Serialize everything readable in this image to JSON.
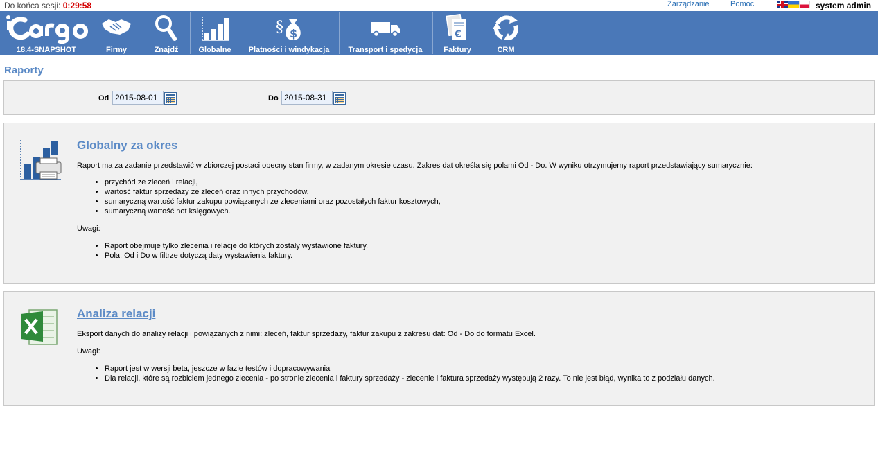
{
  "session": {
    "label": "Do końca sesji:",
    "timer": "0:29:58"
  },
  "toplinks": {
    "management": "Zarządzanie",
    "help": "Pomoc"
  },
  "user": {
    "name": "system admin"
  },
  "nav": {
    "logo_version": "18.4-SNAPSHOT",
    "items": [
      {
        "label": "Firmy",
        "icon": "handshake-icon"
      },
      {
        "label": "Znajdź",
        "icon": "magnifier-icon"
      },
      {
        "label": "Globalne",
        "icon": "bar-chart-icon"
      },
      {
        "label": "Płatności i windykacja",
        "icon": "money-bag-icon"
      },
      {
        "label": "Transport i spedycja",
        "icon": "truck-icon"
      },
      {
        "label": "Faktury",
        "icon": "invoice-icon"
      },
      {
        "label": "CRM",
        "icon": "cycle-arrows-icon"
      }
    ]
  },
  "page": {
    "title": "Raporty"
  },
  "filter": {
    "from_label": "Od",
    "from_value": "2015-08-01",
    "to_label": "Do",
    "to_value": "2015-08-31"
  },
  "reports": [
    {
      "title": "Globalny za okres",
      "description": "Raport ma za zadanie przedstawić w zbiorczej postaci obecny stan firmy, w zadanym okresie czasu. Zakres dat określa się polami Od - Do. W wyniku otrzymujemy raport przedstawiający sumarycznie:",
      "items": [
        "przychód ze zleceń i relacji,",
        "wartość faktur sprzedaży ze zleceń oraz innych przychodów,",
        "sumaryczną wartość faktur zakupu powiązanych ze zleceniami oraz pozostałych faktur kosztowych,",
        "sumaryczną wartość not księgowych."
      ],
      "notes_label": "Uwagi:",
      "notes": [
        "Raport obejmuje tylko zlecenia i relacje do których zostały wystawione faktury.",
        "Pola: Od i Do w filtrze dotyczą daty wystawienia faktury."
      ]
    },
    {
      "title": "Analiza relacji",
      "description": "Eksport danych do analizy relacji i powiązanych z nimi: zleceń, faktur sprzedaży, faktur zakupu z zakresu dat: Od - Do do formatu Excel.",
      "notes_label": "Uwagi:",
      "notes": [
        "Raport jest w wersji beta, jeszcze w fazie testów i dopracowywania",
        "Dla relacji, które są rozbiciem jednego zlecenia - po stronie zlecenia i faktury sprzedaży - zlecenie i faktura sprzedaży występują 2 razy. To nie jest błąd, wynika to z podziału danych."
      ]
    }
  ],
  "colors": {
    "nav_bg": "#4a78b8",
    "title": "#5b8ac6",
    "timer": "#d40000",
    "link": "#2a6fb5"
  }
}
